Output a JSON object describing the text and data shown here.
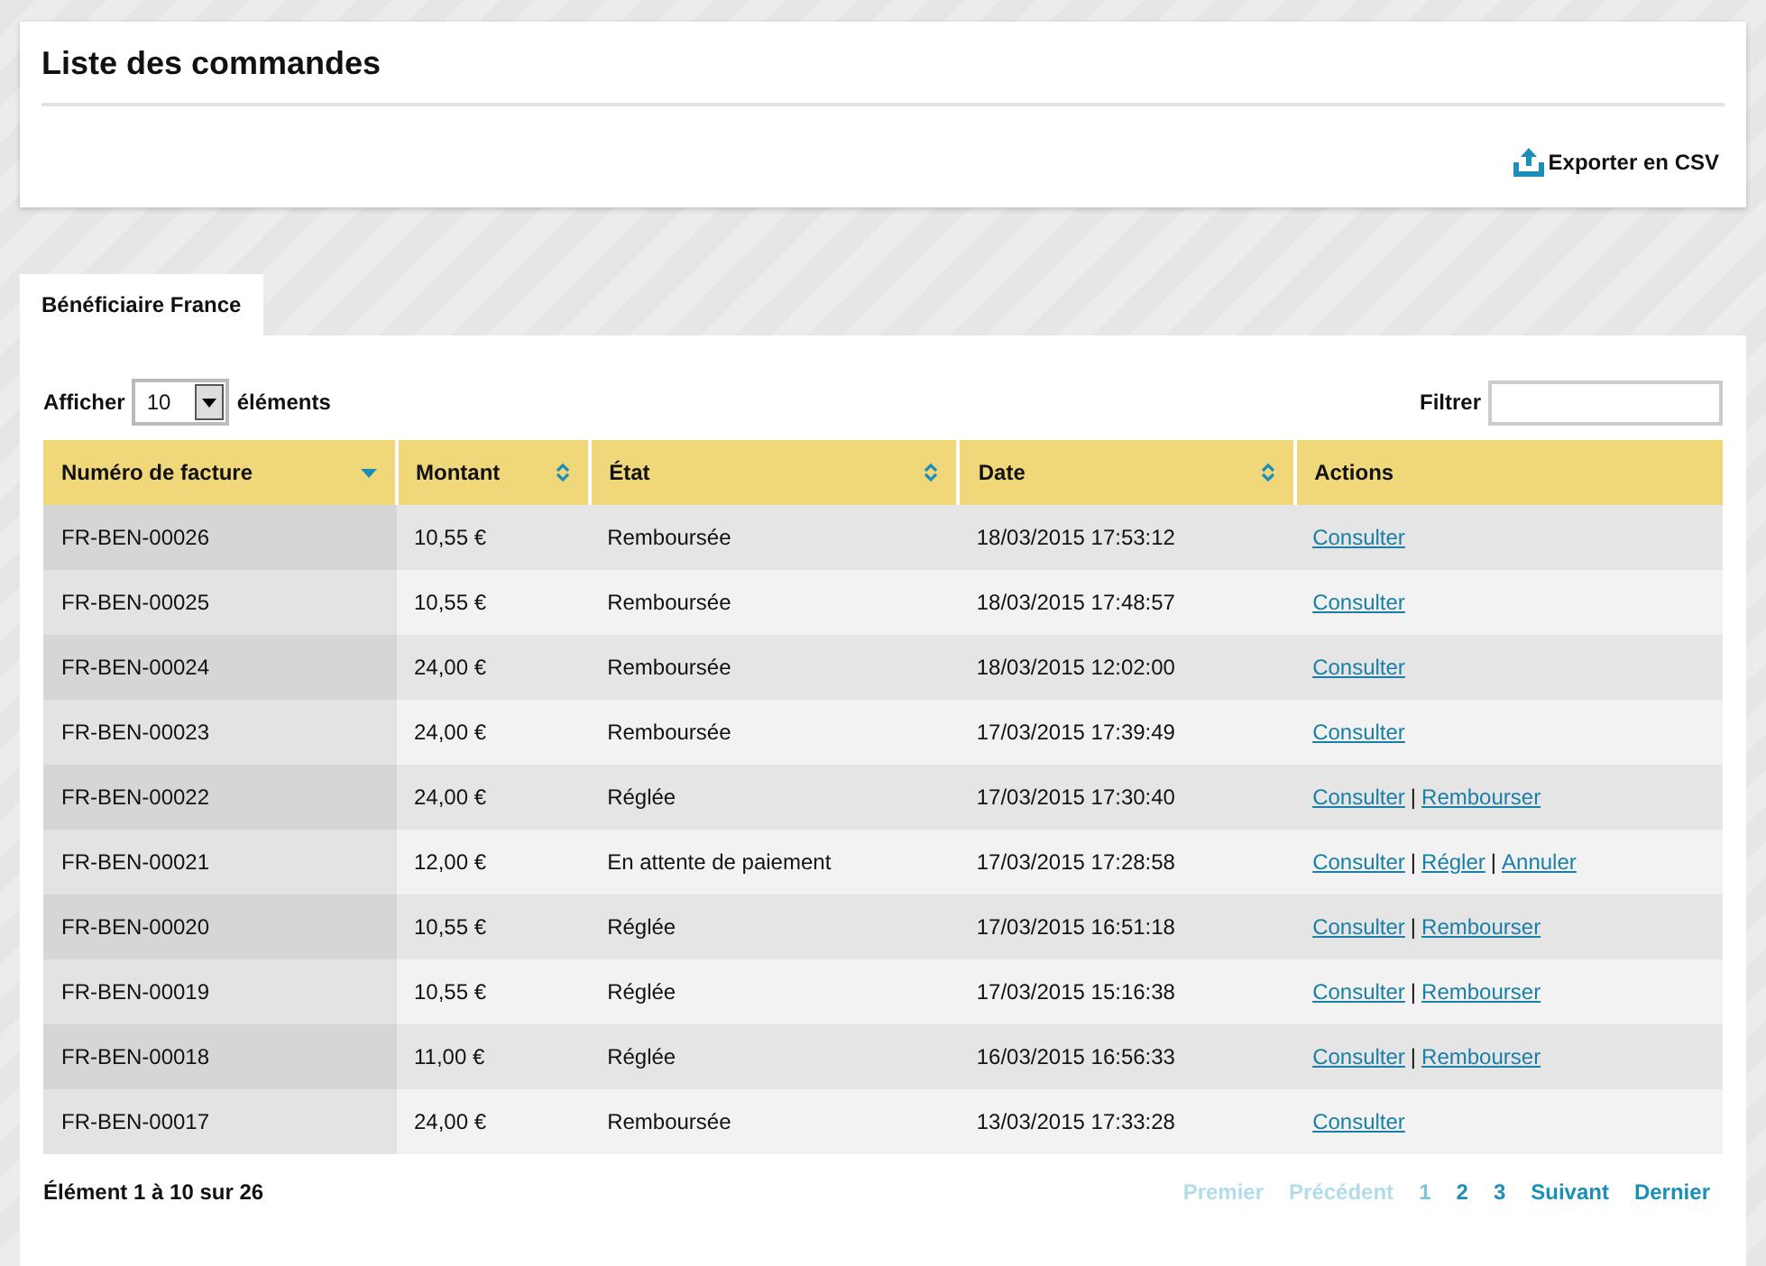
{
  "header": {
    "title": "Liste des commandes",
    "export_label": "Exporter en CSV"
  },
  "tabs": [
    {
      "label": "Bénéficiaire France",
      "selected": true
    }
  ],
  "length_control": {
    "before": "Afficher",
    "value": "10",
    "after": "éléments"
  },
  "filter": {
    "label": "Filtrer"
  },
  "table": {
    "columns": [
      {
        "label": "Numéro de facture",
        "sortable": true,
        "sorted_descending": true
      },
      {
        "label": "Montant",
        "sortable": true,
        "sorted_descending": false
      },
      {
        "label": "État",
        "sortable": true,
        "sorted_descending": false
      },
      {
        "label": "Date",
        "sortable": true,
        "sorted_descending": false
      },
      {
        "label": "Actions",
        "sortable": false,
        "sorted_descending": false
      }
    ],
    "rows": [
      {
        "invoice": "FR-BEN-00026",
        "amount": "10,55 €",
        "state": "Remboursée",
        "date": "18/03/2015 17:53:12",
        "actions": [
          {
            "kind": "link",
            "text": "Consulter"
          }
        ]
      },
      {
        "invoice": "FR-BEN-00025",
        "amount": "10,55 €",
        "state": "Remboursée",
        "date": "18/03/2015 17:48:57",
        "actions": [
          {
            "kind": "link",
            "text": "Consulter"
          }
        ]
      },
      {
        "invoice": "FR-BEN-00024",
        "amount": "24,00 €",
        "state": "Remboursée",
        "date": "18/03/2015 12:02:00",
        "actions": [
          {
            "kind": "link",
            "text": "Consulter"
          }
        ]
      },
      {
        "invoice": "FR-BEN-00023",
        "amount": "24,00 €",
        "state": "Remboursée",
        "date": "17/03/2015 17:39:49",
        "actions": [
          {
            "kind": "link",
            "text": "Consulter"
          }
        ]
      },
      {
        "invoice": "FR-BEN-00022",
        "amount": "24,00 €",
        "state": "Réglée",
        "date": "17/03/2015 17:30:40",
        "actions": [
          {
            "kind": "link",
            "text": "Consulter"
          },
          {
            "kind": "separator",
            "text": "|"
          },
          {
            "kind": "link",
            "text": "Rembourser"
          }
        ]
      },
      {
        "invoice": "FR-BEN-00021",
        "amount": "12,00 €",
        "state": "En attente de paiement",
        "date": "17/03/2015 17:28:58",
        "actions": [
          {
            "kind": "link",
            "text": "Consulter"
          },
          {
            "kind": "separator",
            "text": "|"
          },
          {
            "kind": "link",
            "text": "Régler"
          },
          {
            "kind": "separator",
            "text": "|"
          },
          {
            "kind": "link",
            "text": "Annuler"
          }
        ]
      },
      {
        "invoice": "FR-BEN-00020",
        "amount": "10,55 €",
        "state": "Réglée",
        "date": "17/03/2015 16:51:18",
        "actions": [
          {
            "kind": "link",
            "text": "Consulter"
          },
          {
            "kind": "separator",
            "text": "|"
          },
          {
            "kind": "link",
            "text": "Rembourser"
          }
        ]
      },
      {
        "invoice": "FR-BEN-00019",
        "amount": "10,55 €",
        "state": "Réglée",
        "date": "17/03/2015 15:16:38",
        "actions": [
          {
            "kind": "link",
            "text": "Consulter"
          },
          {
            "kind": "separator",
            "text": "|"
          },
          {
            "kind": "link",
            "text": "Rembourser"
          }
        ]
      },
      {
        "invoice": "FR-BEN-00018",
        "amount": "11,00 €",
        "state": "Réglée",
        "date": "16/03/2015 16:56:33",
        "actions": [
          {
            "kind": "link",
            "text": "Consulter"
          },
          {
            "kind": "separator",
            "text": "|"
          },
          {
            "kind": "link",
            "text": "Rembourser"
          }
        ]
      },
      {
        "invoice": "FR-BEN-00017",
        "amount": "24,00 €",
        "state": "Remboursée",
        "date": "13/03/2015 17:33:28",
        "actions": [
          {
            "kind": "link",
            "text": "Consulter"
          }
        ]
      }
    ]
  },
  "info": "Élément 1 à 10 sur 26",
  "pagination": [
    {
      "label": "Premier",
      "disabled": true,
      "selected": false
    },
    {
      "label": "Précédent",
      "disabled": true,
      "selected": false
    },
    {
      "label": "1",
      "disabled": false,
      "selected": true
    },
    {
      "label": "2",
      "disabled": false,
      "selected": false
    },
    {
      "label": "3",
      "disabled": false,
      "selected": false
    },
    {
      "label": "Suivant",
      "disabled": false,
      "selected": false
    },
    {
      "label": "Dernier",
      "disabled": false,
      "selected": false
    }
  ]
}
